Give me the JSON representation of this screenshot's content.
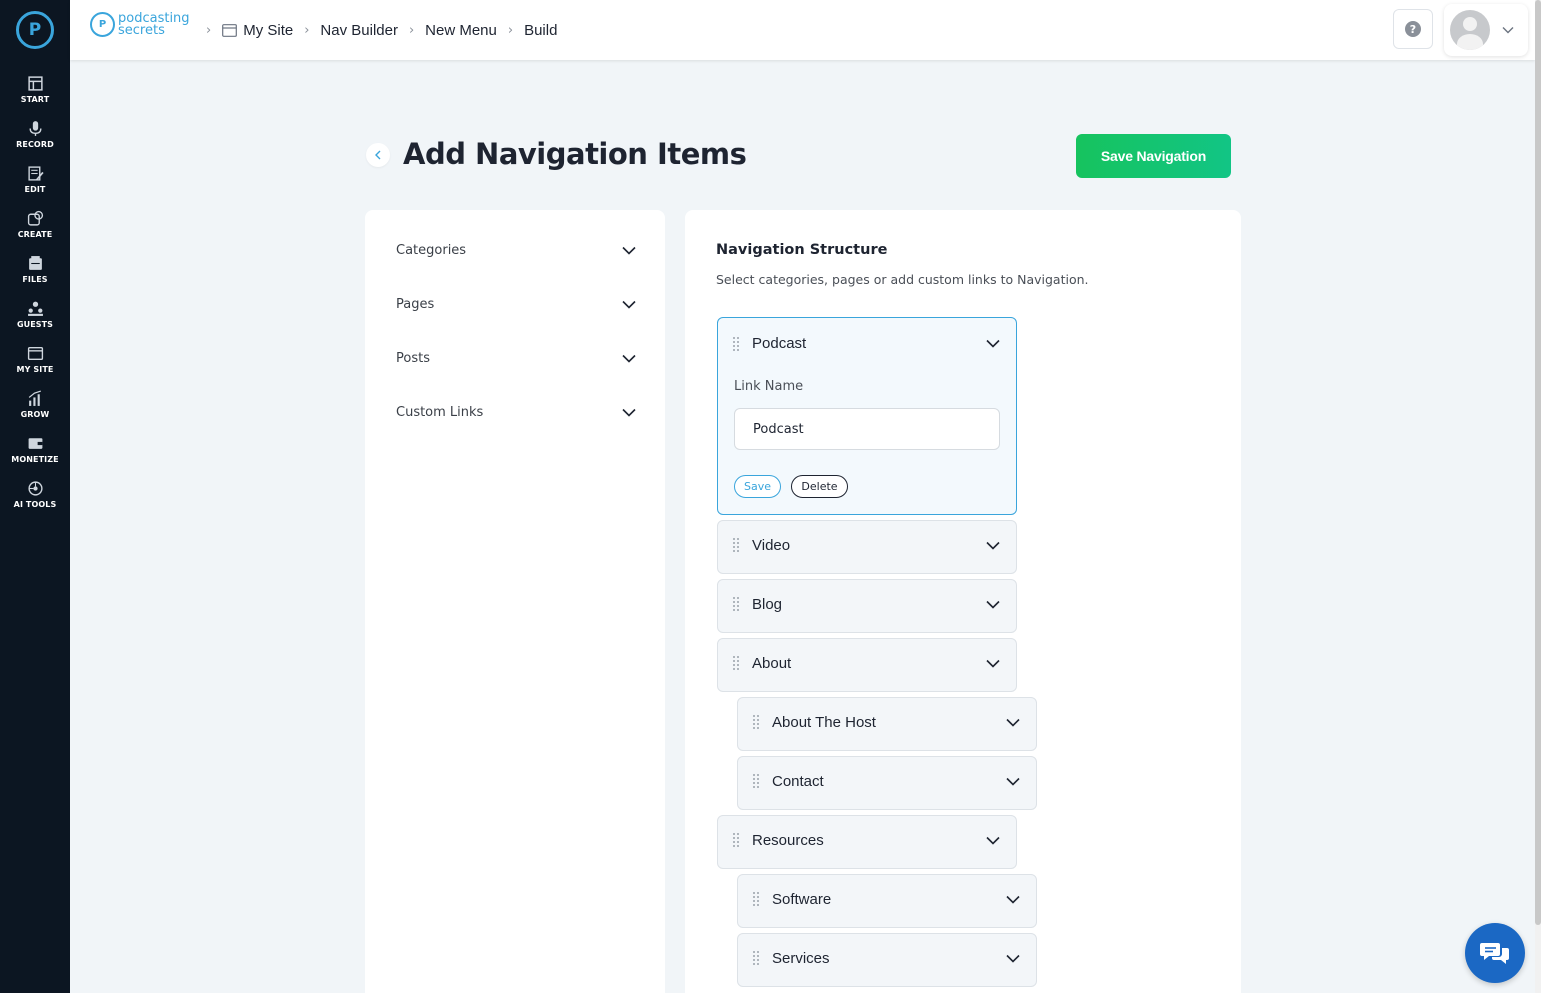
{
  "sidebar": {
    "items": [
      {
        "label": "START",
        "icon": "start-icon"
      },
      {
        "label": "RECORD",
        "icon": "mic-icon"
      },
      {
        "label": "EDIT",
        "icon": "edit-icon"
      },
      {
        "label": "CREATE",
        "icon": "create-icon"
      },
      {
        "label": "FILES",
        "icon": "files-icon"
      },
      {
        "label": "GUESTS",
        "icon": "guests-icon"
      },
      {
        "label": "MY SITE",
        "icon": "my-site-icon"
      },
      {
        "label": "GROW",
        "icon": "grow-icon"
      },
      {
        "label": "MONETIZE",
        "icon": "monetize-icon"
      },
      {
        "label": "AI TOOLS",
        "icon": "ai-tools-icon"
      }
    ]
  },
  "brand": {
    "line1": "podcasting",
    "line2": "secrets"
  },
  "breadcrumb": [
    "My Site",
    "Nav Builder",
    "New Menu",
    "Build"
  ],
  "header": {
    "help_icon": "?"
  },
  "page": {
    "title": "Add Navigation Items",
    "save_label": "Save Navigation"
  },
  "left_panel": {
    "items": [
      "Categories",
      "Pages",
      "Posts",
      "Custom Links"
    ]
  },
  "nav_structure": {
    "title": "Navigation Structure",
    "subtitle": "Select categories, pages or add custom links to Navigation.",
    "open_item": {
      "label": "Podcast",
      "link_name_label": "Link Name",
      "link_name_value": "Podcast",
      "save_label": "Save",
      "delete_label": "Delete"
    },
    "items": [
      {
        "label": "Video",
        "level": 0
      },
      {
        "label": "Blog",
        "level": 0
      },
      {
        "label": "About",
        "level": 0
      },
      {
        "label": "About The Host",
        "level": 1
      },
      {
        "label": "Contact",
        "level": 1
      },
      {
        "label": "Resources",
        "level": 0
      },
      {
        "label": "Software",
        "level": 1
      },
      {
        "label": "Services",
        "level": 1
      }
    ]
  },
  "colors": {
    "accent": "#3aa5dc",
    "save_green": "#16c35e",
    "sidebar_bg": "#0c1622",
    "chat_blue": "#1b68c4"
  }
}
